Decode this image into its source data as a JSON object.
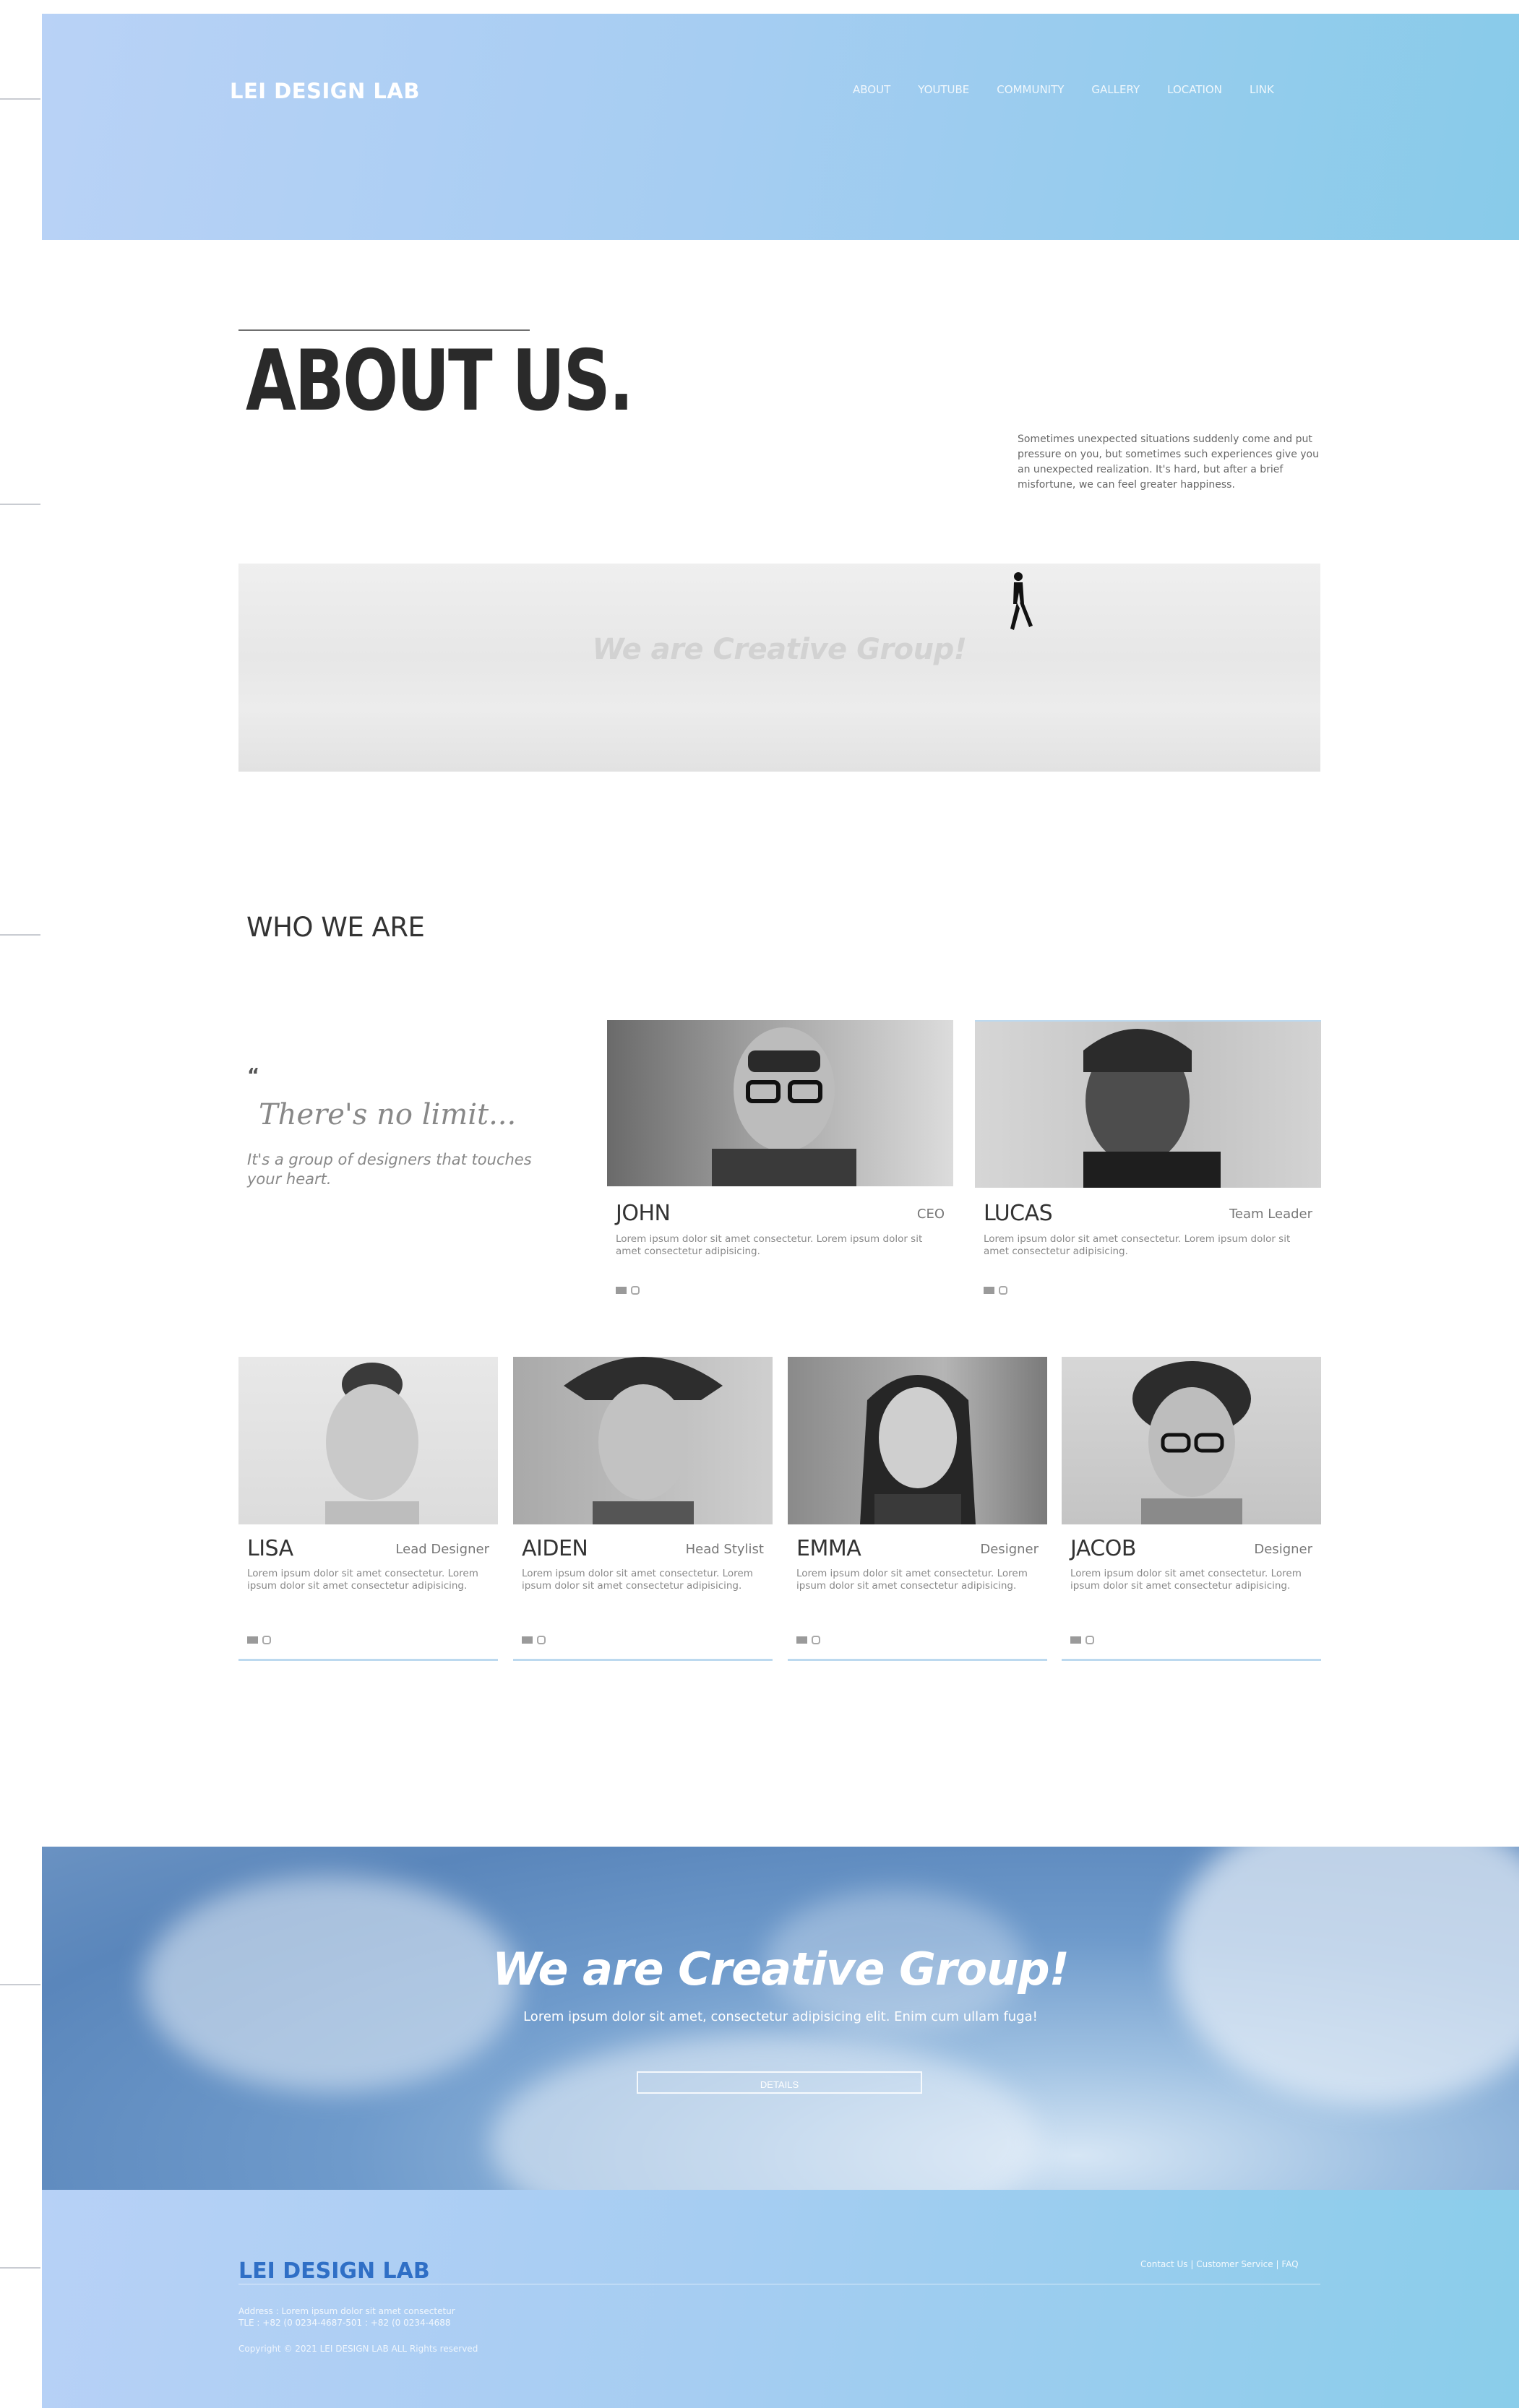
{
  "header": {
    "logo": "LEI DESIGN LAB",
    "nav": [
      "ABOUT",
      "YOUTUBE",
      "COMMUNITY",
      "GALLERY",
      "LOCATION",
      "LINK"
    ]
  },
  "about": {
    "title": "ABOUT US.",
    "description": "Sometimes unexpected situations suddenly come and put pressure on you, but sometimes such experiences give you an unexpected realization. It's hard, but after a brief misfortune, we can feel greater happiness.",
    "image_caption": "We are Creative Group!"
  },
  "who": {
    "title": "WHO WE ARE",
    "quote_mark": "“",
    "quote": "There's no limit...",
    "quote_sub": "It's a group of designers that touches your heart."
  },
  "team_top": [
    {
      "name": "JOHN",
      "role": "CEO",
      "bio": "Lorem ipsum dolor sit amet consectetur. Lorem ipsum dolor sit amet consectetur adipisicing."
    },
    {
      "name": "LUCAS",
      "role": "Team Leader",
      "bio": "Lorem ipsum dolor sit amet consectetur. Lorem ipsum dolor sit amet consectetur adipisicing."
    }
  ],
  "team_bottom": [
    {
      "name": "LISA",
      "role": "Lead Designer",
      "bio": "Lorem ipsum dolor sit amet consectetur. Lorem ipsum dolor sit amet consectetur adipisicing."
    },
    {
      "name": "AIDEN",
      "role": "Head Stylist",
      "bio": "Lorem ipsum dolor sit amet consectetur. Lorem ipsum dolor sit amet consectetur adipisicing."
    },
    {
      "name": "EMMA",
      "role": "Designer",
      "bio": "Lorem ipsum dolor sit amet consectetur. Lorem ipsum dolor sit amet consectetur adipisicing."
    },
    {
      "name": "JACOB",
      "role": "Designer",
      "bio": "Lorem ipsum dolor sit amet consectetur. Lorem ipsum dolor sit amet consectetur adipisicing."
    }
  ],
  "cta": {
    "title": "We are Creative Group!",
    "subtitle": "Lorem ipsum dolor sit amet, consectetur adipisicing elit. Enim cum ullam fuga!",
    "button": "DETAILS"
  },
  "footer": {
    "logo": "LEI DESIGN LAB",
    "links": "Contact Us | Customer Service | FAQ",
    "address_line1": "Address : Lorem ipsum dolor sit amet consectetur",
    "address_line2": "TLE : +82 (0 0234-4687-501 : +82 (0 0234-4688",
    "copyright": "Copyright © 2021 LEI DESIGN LAB ALL Rights reserved"
  },
  "colors": {
    "header_gradient": [
      "#b9d2f6",
      "#88cbe9"
    ],
    "accent_blue": "#2f6fc6",
    "card_underline": "#bcd9ef"
  },
  "icons": [
    "mail-icon",
    "instagram-icon",
    "person-walking-illustration",
    "quote-icon"
  ]
}
